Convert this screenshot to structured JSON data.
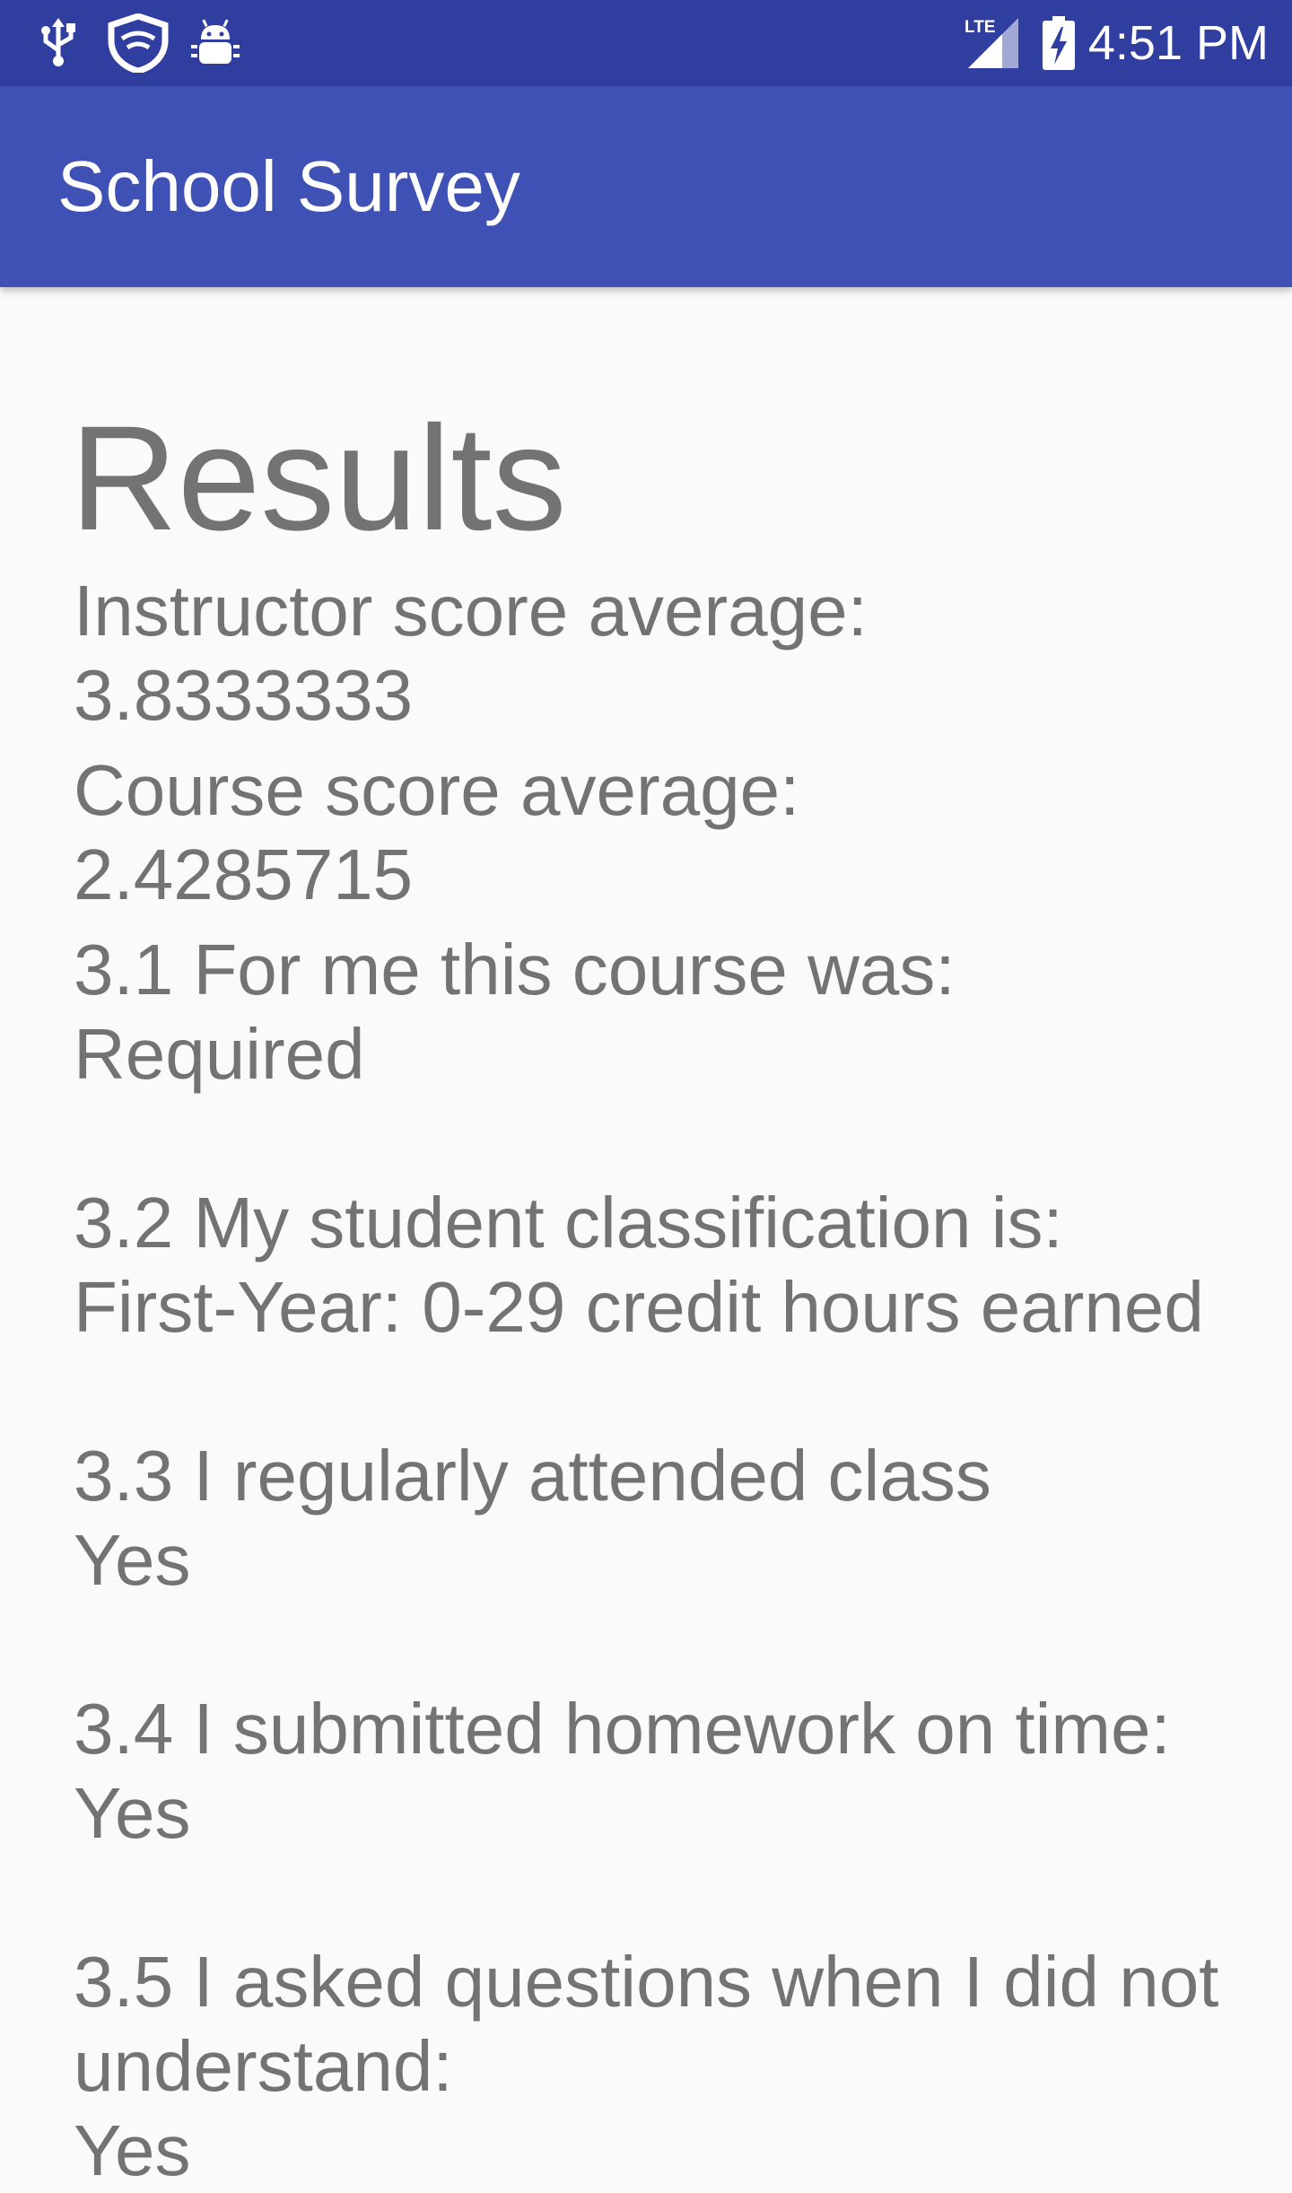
{
  "status_bar": {
    "time": "4:51 PM",
    "network": "LTE",
    "icons": [
      "usb-icon",
      "shield-icon",
      "android-debug-icon",
      "lte-signal-icon",
      "battery-charging-icon"
    ]
  },
  "app_bar": {
    "title": "School Survey"
  },
  "results": {
    "heading": "Results",
    "instructor_label": "Instructor score average:",
    "instructor_value": "3.8333333",
    "course_label": "Course score average:",
    "course_value": "2.4285715",
    "answers": [
      {
        "question": "3.1 For me this course was:",
        "answer": "Required"
      },
      {
        "question": "3.2 My student classification is:",
        "answer": "First-Year: 0-29 credit hours earned"
      },
      {
        "question": "3.3 I regularly attended class",
        "answer": "Yes"
      },
      {
        "question": "3.4 I submitted homework on time:",
        "answer": "Yes"
      },
      {
        "question_line1": "3.5 I asked questions when I did not",
        "question_line2": "understand:",
        "answer": "Yes"
      }
    ]
  },
  "colors": {
    "status_bar": "#303f9f",
    "app_bar": "#3f51b5",
    "background": "#fafafa",
    "text": "#737373"
  }
}
